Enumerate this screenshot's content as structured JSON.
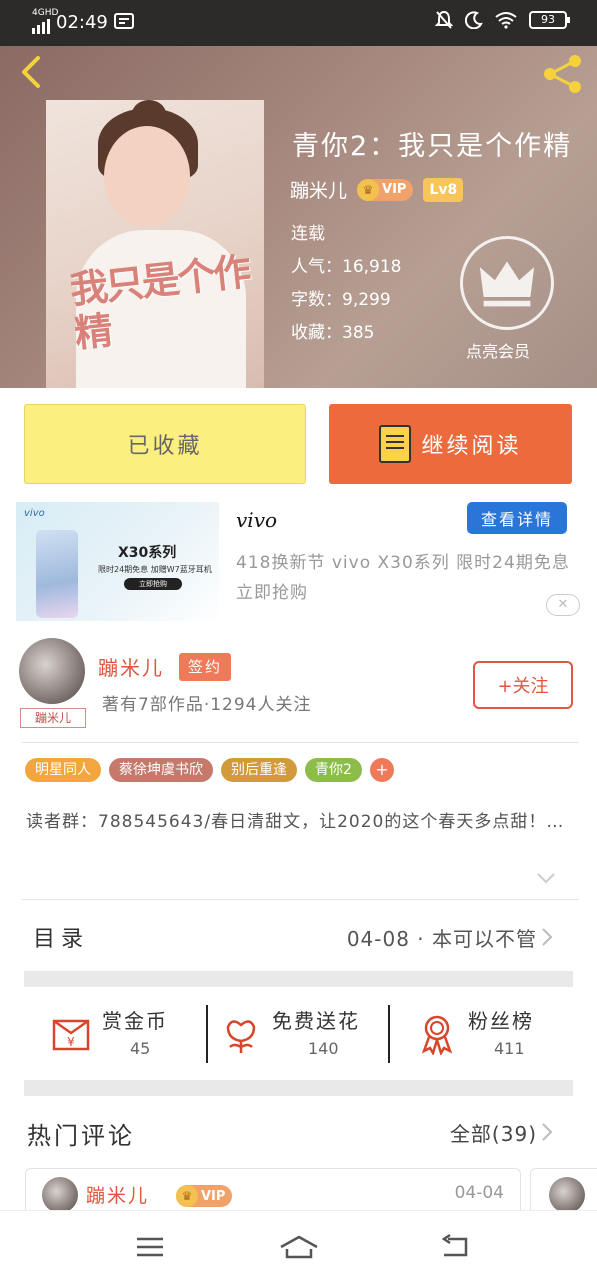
{
  "status_bar": {
    "network": "4GHD",
    "time": "02:49",
    "battery": "93"
  },
  "book": {
    "title": "青你2：我只是个作精",
    "cover_title": "我只是个作精",
    "author": "蹦米儿",
    "vip_label": "VIP",
    "level": "Lv8",
    "status": "连载",
    "popularity": "人气：16,918",
    "word_count": "字数：9,299",
    "favorites": "收藏：385",
    "member_label": "点亮会员"
  },
  "actions": {
    "favorited_label": "已收藏",
    "continue_label": "继续阅读"
  },
  "ad": {
    "brand": "vivo",
    "detail_button": "查看详情",
    "text": "418换新节 vivo X30系列 限时24期免息 立即抢购",
    "image_brand": "vivo",
    "image_model": "X30系列",
    "image_sub": "限时24期免息 加赠W7蓝牙耳机",
    "image_btn": "立即抢购",
    "close": "✕"
  },
  "author_card": {
    "name": "蹦米儿",
    "signed_label": "签约",
    "works_info": "著有7部作品·1294人关注",
    "follow_label": "+关注",
    "signature": "蹦米儿"
  },
  "tags": [
    {
      "label": "明星同人",
      "color": "#f4a63e"
    },
    {
      "label": "蔡徐坤虞书欣",
      "color": "#c6786a"
    },
    {
      "label": "别后重逢",
      "color": "#d39a3c"
    },
    {
      "label": "青你2",
      "color": "#8cbd4b"
    }
  ],
  "tag_more": "+",
  "intro": "读者群：788545643/春日清甜文，让2020的这个春天多点甜！…",
  "catalog": {
    "label": "目录",
    "latest": "04-08 · 本可以不管"
  },
  "stats": [
    {
      "label": "赏金币",
      "value": "45",
      "icon": "red-envelope-icon"
    },
    {
      "label": "免费送花",
      "value": "140",
      "icon": "flower-icon"
    },
    {
      "label": "粉丝榜",
      "value": "411",
      "icon": "medal-icon"
    }
  ],
  "comments": {
    "title": "热门评论",
    "all_label": "全部(39)",
    "first": {
      "name": "蹦米儿",
      "vip": "VIP",
      "date": "04-04"
    }
  },
  "colors": {
    "accent": "#ec6a3c",
    "favorite_button": "#fbf07f",
    "author_name": "#e0563e",
    "ad_button": "#2a76d8"
  }
}
